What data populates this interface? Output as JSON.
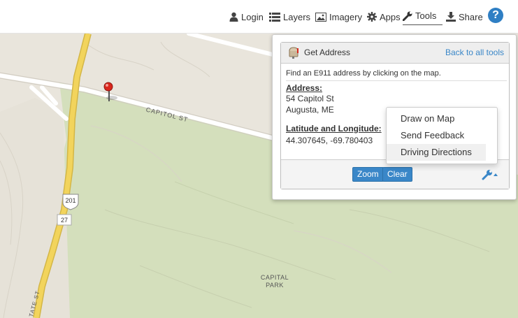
{
  "nav": {
    "login": "Login",
    "layers": "Layers",
    "imagery": "Imagery",
    "apps": "Apps",
    "tools": "Tools",
    "share": "Share",
    "help": "?"
  },
  "tools_panel": {
    "title": "Get Address",
    "back_link": "Back to all tools",
    "instructions": "Find an E911 address by clicking on the map.",
    "address_label": "Address:",
    "address_line1": "54 Capitol St",
    "address_line2": "Augusta, ME",
    "latlon_label": "Latitude and Longitude:",
    "latlon_value": "44.307645, -69.780403",
    "zoom_label": "Zoom",
    "clear_label": "Clear"
  },
  "dropdown": {
    "items": [
      "Draw on Map",
      "Send Feedback",
      "Driving Directions"
    ]
  },
  "map": {
    "road_label": "CAPITOL ST",
    "park_label_1": "CAPITAL",
    "park_label_2": "PARK",
    "shield_201": "201",
    "shield_27": "27",
    "state_st_label": "TATE ST"
  },
  "colors": {
    "accent": "#3a87c8",
    "park": "#d4dfbc",
    "land": "#e9e5dc",
    "highway": "#f2d45c"
  }
}
